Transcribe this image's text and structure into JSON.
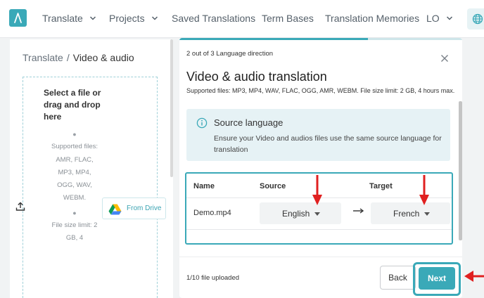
{
  "nav": {
    "logo_icon": "a-logo-icon",
    "items": [
      {
        "label": "Translate",
        "has_dropdown": true
      },
      {
        "label": "Projects",
        "has_dropdown": true
      },
      {
        "label": "Saved Translations",
        "has_dropdown": false
      },
      {
        "label": "Term Bases",
        "has_dropdown": false
      },
      {
        "label": "Translation Memories",
        "has_dropdown": false
      },
      {
        "label": "LO",
        "has_dropdown": true
      }
    ],
    "globe_icon": "globe-icon"
  },
  "breadcrumb": {
    "parent": "Translate",
    "separator": "/",
    "current": "Video & audio"
  },
  "dropzone": {
    "title": "Select a file or drag and drop here",
    "supported_files": "Supported files: AMR, FLAC, MP3, MP4, OGG, WAV, WEBM.",
    "size_limit": "File size limit: 2 GB, 4",
    "drive_button": "From Drive",
    "upload_icon": "upload-icon",
    "drive_icon": "google-drive-icon"
  },
  "modal": {
    "step_text": "2 out of 3 Language direction",
    "progress": 0.667,
    "title": "Video & audio translation",
    "supported": "Supported files: MP3, MP4, WAV, FLAC, OGG, AMR, WEBM. File size limit: 2 GB, 4 hours max.",
    "info": {
      "icon": "info-icon",
      "title": "Source language",
      "text": "Ensure your Video and audios files use the same source language for translation"
    },
    "table": {
      "headers": {
        "name": "Name",
        "source": "Source",
        "target": "Target"
      },
      "rows": [
        {
          "name": "Demo.mp4",
          "source": "English",
          "target": "French"
        }
      ]
    },
    "uploaded": "1/10 file uploaded",
    "back_label": "Back",
    "next_label": "Next"
  },
  "colors": {
    "accent": "#3aa9b8",
    "annotation": "#e02020",
    "info_bg": "#e6f2f5"
  }
}
